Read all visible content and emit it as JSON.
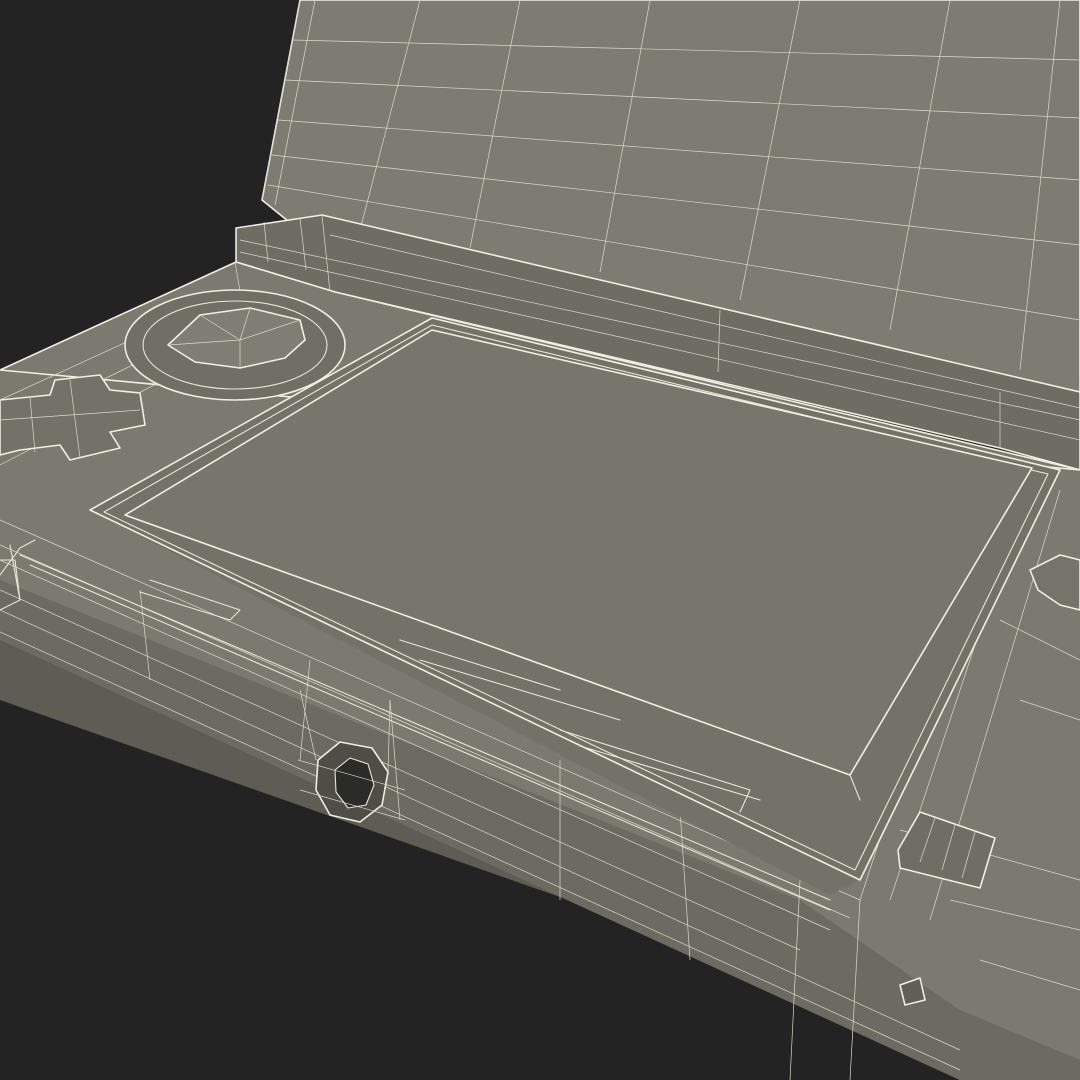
{
  "scene": {
    "subject": "handheld-console-wireframe-render",
    "colors": {
      "background": "#232323",
      "body": "#7a7a70",
      "body_dark": "#6b6b62",
      "body_shadow": "#5d5d55",
      "screen": "#76766c",
      "upper_lid": "#7c7c72",
      "hinge": "#6d6d64",
      "wire": "#e9e6d6"
    }
  }
}
